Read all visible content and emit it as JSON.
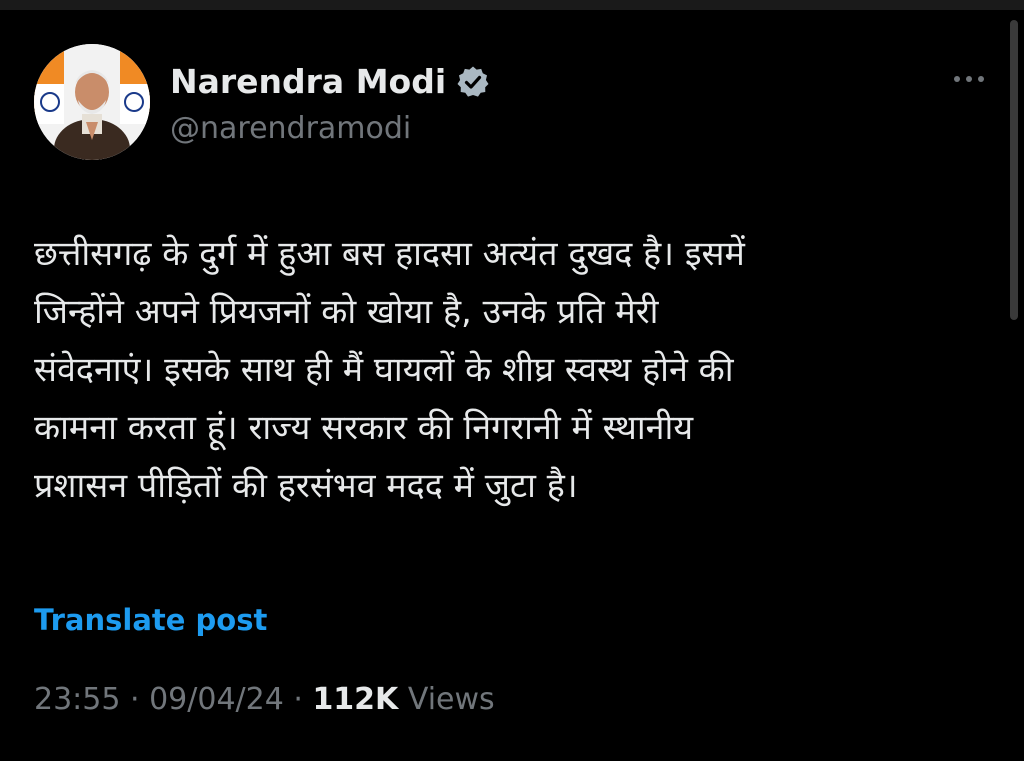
{
  "author": {
    "display_name": "Narendra Modi",
    "handle": "@narendramodi",
    "verified_icon": "verified-badge-icon",
    "avatar_icon": "profile-photo"
  },
  "menu": {
    "icon": "more-options-icon"
  },
  "tweet": {
    "lines": [
      "छत्तीसगढ़ के दुर्ग में हुआ बस हादसा अत्यंत दुखद है। इसमें",
      "जिन्होंने अपने प्रियजनों को खोया है, उनके प्रति मेरी",
      "संवेदनाएं। इसके साथ ही मैं घायलों के शीघ्र स्वस्थ होने की",
      "कामना करता हूं। राज्य सरकार की निगरानी में स्थानीय",
      "प्रशासन पीड़ितों की हरसंभव मदद में जुटा है।"
    ]
  },
  "translate_label": "Translate post",
  "meta": {
    "time": "23:55",
    "sep1": " · ",
    "date": "09/04/24",
    "sep2": " · ",
    "views_count": "112K",
    "views_label": " Views"
  },
  "colors": {
    "background": "#000000",
    "text_primary": "#e7e9ea",
    "text_secondary": "#71767b",
    "accent": "#1d9bf0"
  }
}
